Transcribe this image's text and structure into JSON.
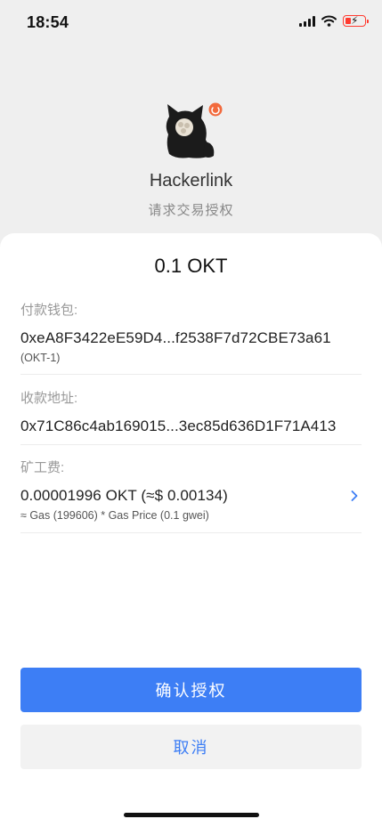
{
  "status_bar": {
    "time": "18:54"
  },
  "app": {
    "name": "Hackerlink",
    "subtitle": "请求交易授权"
  },
  "transaction": {
    "amount": "0.1 OKT",
    "payer": {
      "label": "付款钱包:",
      "address": "0xeA8F3422eE59D4...f2538F7d72CBE73a61",
      "note": "(OKT-1)"
    },
    "receiver": {
      "label": "收款地址:",
      "address": "0x71C86c4ab169015...3ec85d636D1F71A413"
    },
    "fee": {
      "label": "矿工费:",
      "value": "0.00001996 OKT (≈$ 0.00134)",
      "detail": "≈ Gas (199606) * Gas Price (0.1 gwei)"
    }
  },
  "buttons": {
    "confirm": "确认授权",
    "cancel": "取消"
  },
  "colors": {
    "accent": "#3d7ef5",
    "battery": "#ff3b30",
    "badge": "#f26a3d"
  }
}
